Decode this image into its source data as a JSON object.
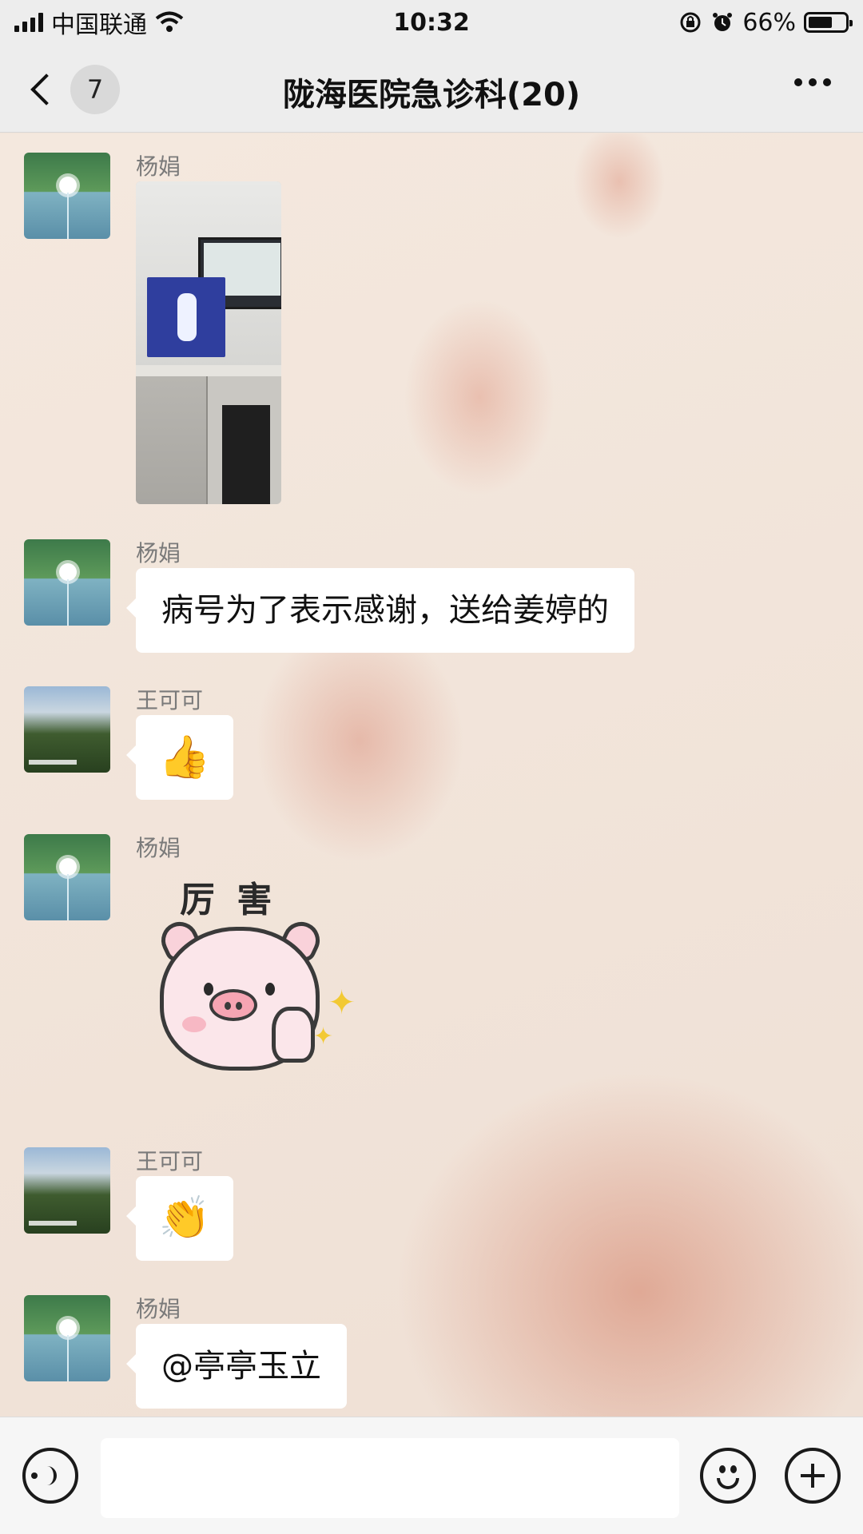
{
  "status_bar": {
    "carrier": "中国联通",
    "time": "10:32",
    "battery_text": "66%",
    "battery_level": 0.66,
    "icons": [
      "signal-icon",
      "wifi-icon",
      "rotation-lock-icon",
      "alarm-icon",
      "battery-icon"
    ]
  },
  "nav": {
    "back_badge": "7",
    "title": "陇海医院急诊科(20)",
    "icons": [
      "chevron-left-icon",
      "more-icon"
    ]
  },
  "messages": [
    {
      "sender": "杨娟",
      "type": "image",
      "description": "photo"
    },
    {
      "sender": "杨娟",
      "type": "text",
      "text": "病号为了表示感谢，送给姜婷的"
    },
    {
      "sender": "王可可",
      "type": "emoji",
      "text": "👍"
    },
    {
      "sender": "杨娟",
      "type": "sticker",
      "text": "厉 害"
    },
    {
      "sender": "王可可",
      "type": "emoji",
      "text": "👏"
    },
    {
      "sender": "杨娟",
      "type": "text",
      "text": "@亭亭玉立"
    }
  ],
  "input_bar": {
    "value": "",
    "icons": [
      "voice-icon",
      "emoji-icon",
      "plus-icon"
    ]
  },
  "colors": {
    "bar_bg": "#ededed",
    "bubble_bg": "#ffffff",
    "chat_bg": "#f1e4d9",
    "sender_name": "#7a7a7a"
  }
}
